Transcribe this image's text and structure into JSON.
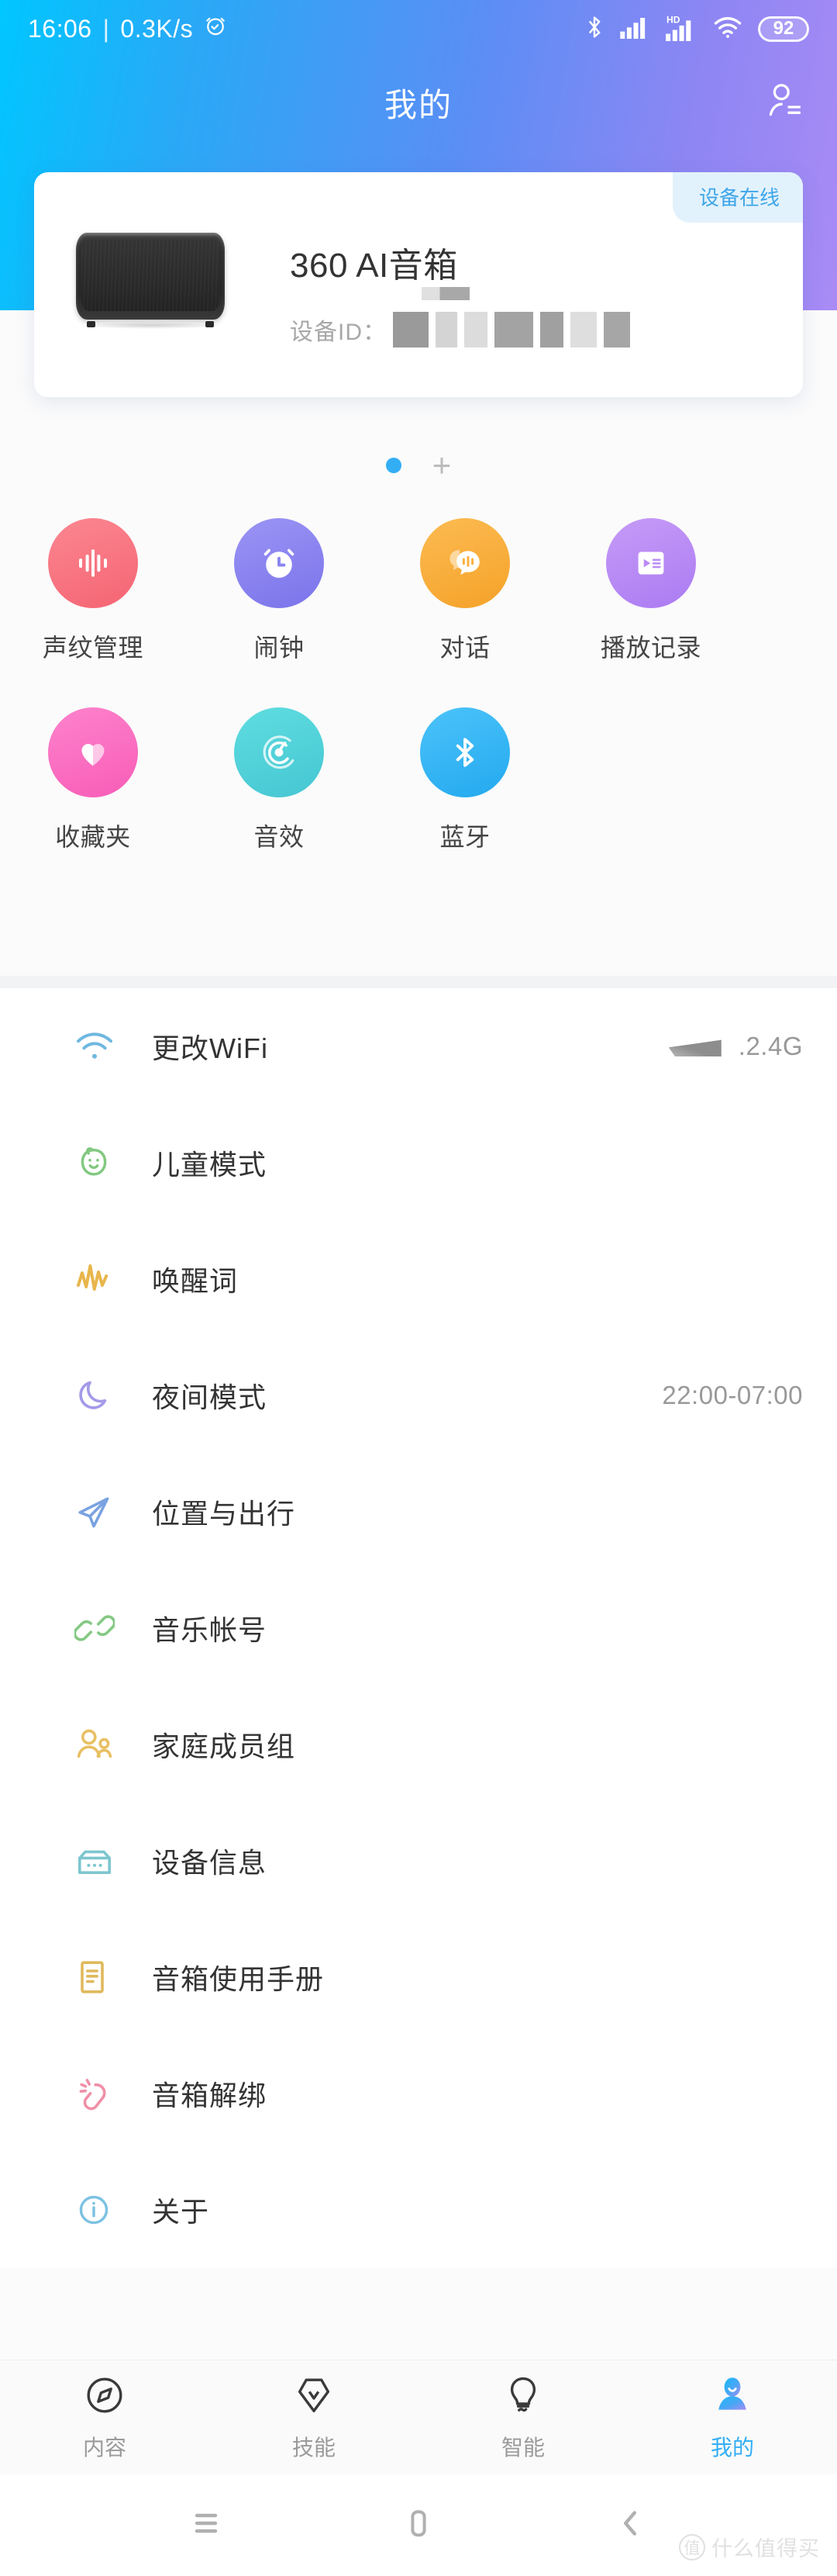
{
  "statusbar": {
    "time": "16:06",
    "separator": "|",
    "netspeed": "0.3K/s",
    "alarm_icon": "alarm-clock-icon",
    "bluetooth_icon": "bluetooth-icon",
    "signal_icon": "cellular-signal-icon",
    "hd_label": "HD",
    "hd_signal_icon": "hd-cellular-signal-icon",
    "wifi_icon": "wifi-icon",
    "battery_level": "92"
  },
  "navbar": {
    "title": "我的",
    "account_icon": "account-list-icon"
  },
  "device_card": {
    "status_badge": "设备在线",
    "name": "360 AI音箱",
    "device_id_label": "设备ID：",
    "device_id_redacted": true,
    "speaker_image": "speaker-device-image",
    "redaction_blocks": [
      {
        "w": 46,
        "shade": "#9a9a9a"
      },
      {
        "w": 28,
        "shade": "#d4d4d4"
      },
      {
        "w": 30,
        "shade": "#dcdcdc"
      },
      {
        "w": 50,
        "shade": "#a3a3a3"
      },
      {
        "w": 30,
        "shade": "#a0a0a0"
      },
      {
        "w": 34,
        "shade": "#dedede"
      },
      {
        "w": 34,
        "shade": "#a6a6a6"
      }
    ]
  },
  "pager": {
    "active_dot": 0,
    "total_dots": 1,
    "add_device_label": "+"
  },
  "shortcuts": [
    {
      "label": "声纹管理",
      "icon": "voiceprint-icon",
      "color": "#f8737f"
    },
    {
      "label": "闹钟",
      "icon": "alarm-clock-icon",
      "color": "#8a86f0"
    },
    {
      "label": "对话",
      "icon": "chat-bubble-icon",
      "color": "#fbb040"
    },
    {
      "label": "播放记录",
      "icon": "playlist-icon",
      "color": "#bb8cf5"
    },
    {
      "label": "收藏夹",
      "icon": "heart-icon",
      "color": "#fb6fc2"
    },
    {
      "label": "音效",
      "icon": "sound-effect-icon",
      "color": "#4fd2d9"
    },
    {
      "label": "蓝牙",
      "icon": "bluetooth-icon",
      "color": "#36b6f5"
    }
  ],
  "settings": [
    {
      "label": "更改WiFi",
      "icon": "wifi-icon",
      "color": "#6fb8e0",
      "value": ".2.4G",
      "redacted_value": true
    },
    {
      "label": "儿童模式",
      "icon": "child-face-icon",
      "color": "#82c880",
      "value": ""
    },
    {
      "label": "唤醒词",
      "icon": "waveform-icon",
      "color": "#e8b64c",
      "value": ""
    },
    {
      "label": "夜间模式",
      "icon": "moon-icon",
      "color": "#a39ae8",
      "value": "22:00-07:00"
    },
    {
      "label": "位置与出行",
      "icon": "paper-plane-icon",
      "color": "#7aa2e0",
      "value": ""
    },
    {
      "label": "音乐帐号",
      "icon": "link-icon",
      "color": "#84c984",
      "value": ""
    },
    {
      "label": "家庭成员组",
      "icon": "people-icon",
      "color": "#e8bf62",
      "value": ""
    },
    {
      "label": "设备信息",
      "icon": "device-box-icon",
      "color": "#7dc6cf",
      "value": ""
    },
    {
      "label": "音箱使用手册",
      "icon": "document-icon",
      "color": "#e0b95c",
      "value": ""
    },
    {
      "label": "音箱解绑",
      "icon": "unbind-icon",
      "color": "#ef8fa8",
      "value": ""
    },
    {
      "label": "关于",
      "icon": "info-circle-icon",
      "color": "#7cc2e2",
      "value": ""
    }
  ],
  "tabbar": [
    {
      "label": "内容",
      "icon": "compass-icon",
      "active": false
    },
    {
      "label": "技能",
      "icon": "pen-nib-icon",
      "active": false
    },
    {
      "label": "智能",
      "icon": "lightbulb-icon",
      "active": false
    },
    {
      "label": "我的",
      "icon": "person-icon",
      "active": true
    }
  ],
  "androidnav": {
    "menu_icon": "menu-icon",
    "home_icon": "home-icon",
    "back_icon": "back-icon"
  },
  "watermark": {
    "mark": "值",
    "text": "什么值得买"
  },
  "colors": {
    "accent": "#33aef5",
    "gradient_start": "#00c6ff",
    "gradient_end": "#a98bf5",
    "badge_bg": "#e2f2fd",
    "badge_text": "#3fa6e8"
  }
}
